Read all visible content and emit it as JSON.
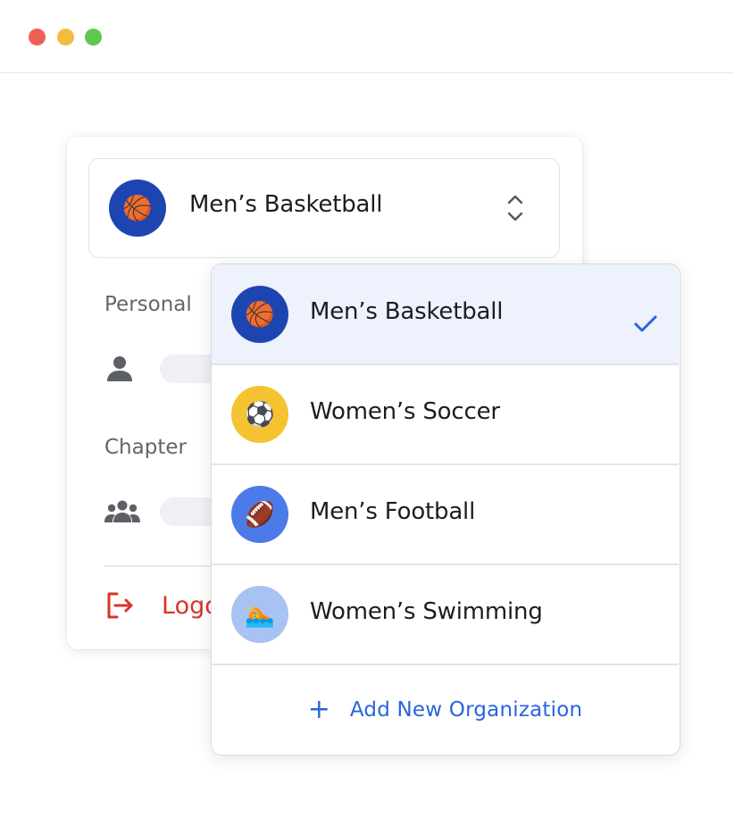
{
  "window": {
    "controls": [
      "close",
      "minimize",
      "maximize"
    ]
  },
  "selector": {
    "current_label": "Men’s Basketball",
    "current_icon": "basketball-icon",
    "toggle_icon": "chevron-up-down-icon"
  },
  "sidebar": {
    "personal_label": "Personal",
    "personal_icon": "person-icon",
    "chapter_label": "Chapter",
    "chapter_icon": "group-icon",
    "logout_label": "Logout",
    "logout_icon": "logout-icon"
  },
  "dropdown": {
    "options": [
      {
        "label": "Men’s Basketball",
        "icon": "basketball-icon",
        "emoji": "🏀",
        "avatar_color": "#1d45b2",
        "selected": true
      },
      {
        "label": "Women’s Soccer",
        "icon": "soccer-ball-icon",
        "emoji": "⚽",
        "avatar_color": "#f6c330",
        "selected": false
      },
      {
        "label": "Men’s Football",
        "icon": "football-icon",
        "emoji": "🏈",
        "avatar_color": "#4b7be8",
        "selected": false
      },
      {
        "label": "Women’s Swimming",
        "icon": "swimmer-icon",
        "emoji": "🏊",
        "avatar_color": "#a8c2f4",
        "selected": false
      }
    ],
    "add_label": "Add New Organization",
    "add_icon": "plus-icon"
  },
  "colors": {
    "accent": "#2a63e0",
    "danger": "#d93328",
    "selected_bg": "#edf2fc"
  }
}
